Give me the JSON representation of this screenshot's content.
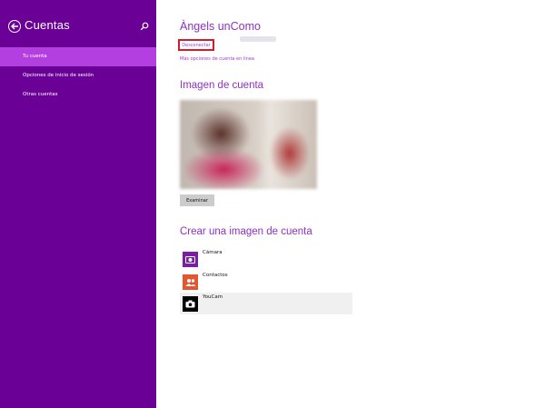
{
  "sidebar": {
    "title": "Cuentas",
    "items": [
      {
        "label": "Tu cuenta",
        "selected": true
      },
      {
        "label": "Opciones de inicio de sesión",
        "selected": false
      },
      {
        "label": "Otras cuentas",
        "selected": false
      }
    ]
  },
  "account": {
    "name": "Àngels unComo",
    "disconnect_label": "Desconectar",
    "more_options_label": "Más opciones de cuenta en línea"
  },
  "image_section": {
    "title": "Imagen de cuenta",
    "browse_label": "Examinar"
  },
  "create_section": {
    "title": "Crear una imagen de cuenta",
    "apps": [
      {
        "label": "Cámara",
        "icon": "camera-icon",
        "color": "#7a1fa2"
      },
      {
        "label": "Contactos",
        "icon": "contacts-icon",
        "color": "#e4572e"
      },
      {
        "label": "YouCam",
        "icon": "youcam-icon",
        "color": "#000000"
      }
    ]
  },
  "colors": {
    "sidebar_bg": "#6a0096",
    "selected_item": "#b33fe0",
    "accent": "#8e31c2",
    "highlight_border": "#cf1d2b"
  }
}
